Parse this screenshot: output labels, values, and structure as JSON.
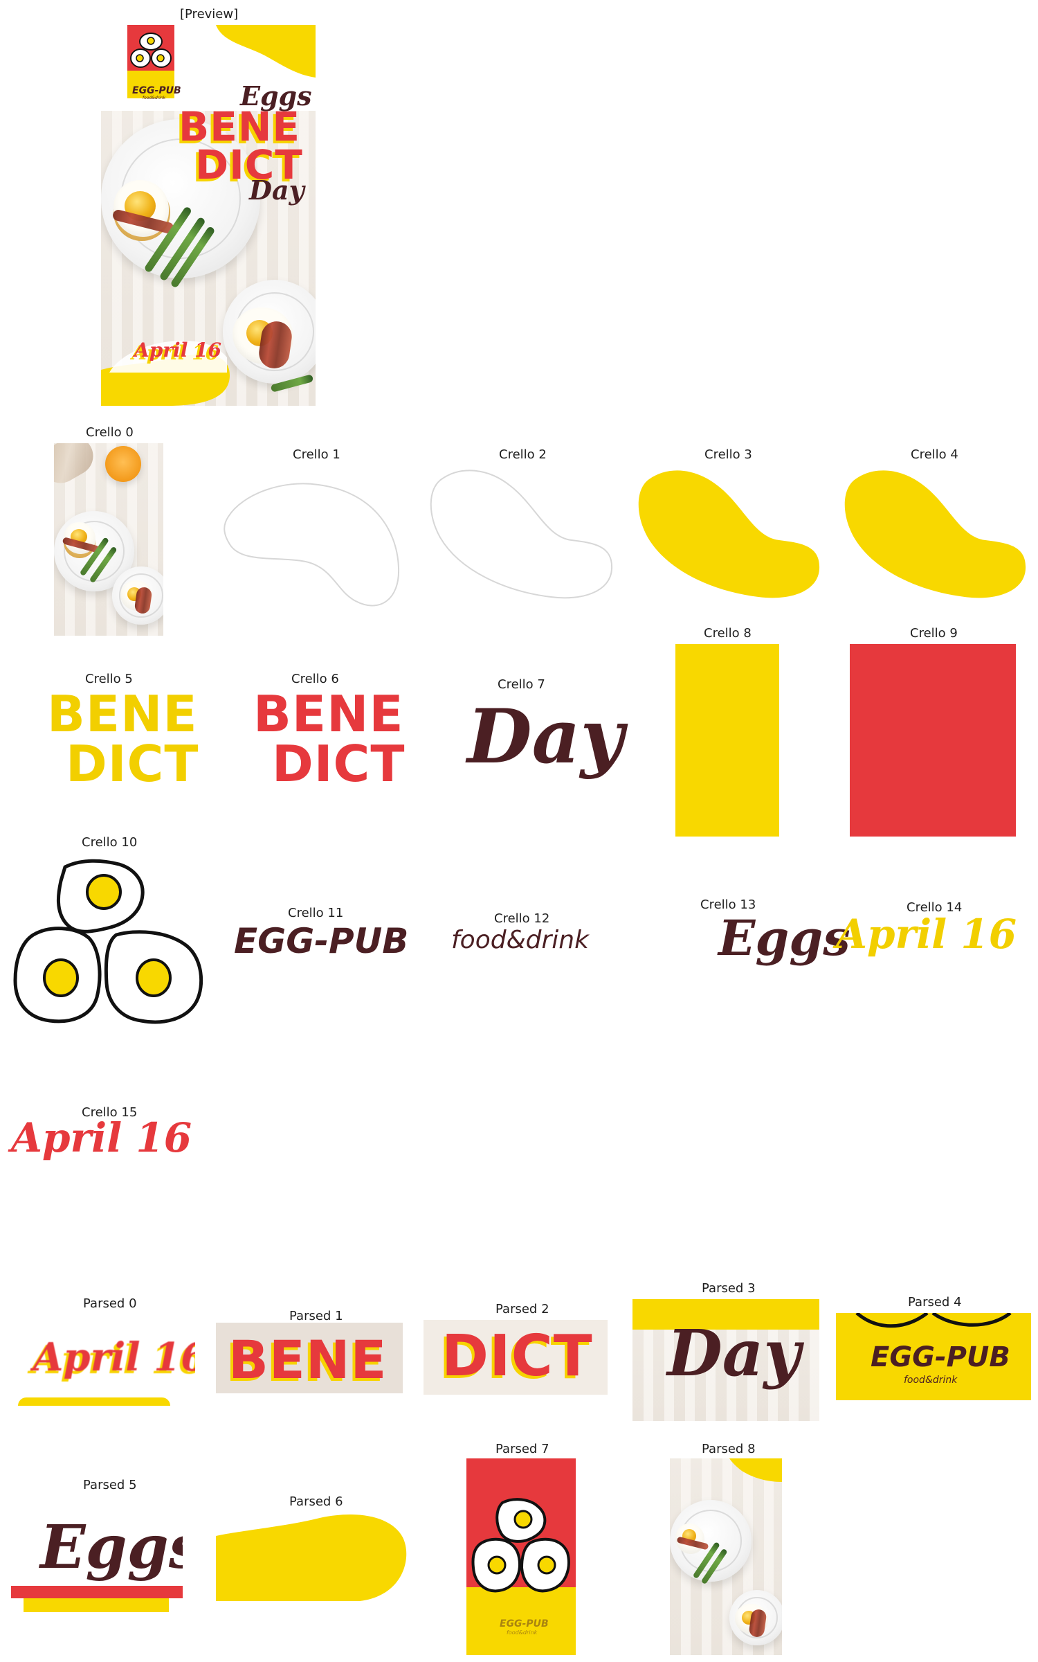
{
  "captions": {
    "preview": "[Preview]",
    "crello": [
      "Crello 0",
      "Crello 1",
      "Crello 2",
      "Crello 3",
      "Crello 4",
      "Crello 5",
      "Crello 6",
      "Crello 7",
      "Crello 8",
      "Crello 9",
      "Crello 10",
      "Crello 11",
      "Crello 12",
      "Crello 13",
      "Crello 14",
      "Crello 15"
    ],
    "parsed": [
      "Parsed 0",
      "Parsed 1",
      "Parsed 2",
      "Parsed 3",
      "Parsed 4",
      "Parsed 5",
      "Parsed 6",
      "Parsed 7",
      "Parsed 8"
    ]
  },
  "texts": {
    "eggs": "Eggs",
    "bene": "BENE",
    "dict": "DICT",
    "day": "Day",
    "egg_pub": "EGG-PUB",
    "food_drink": "food&drink",
    "april_16": "April 16"
  },
  "colors": {
    "yellow": "#f8d800",
    "red": "#e6393d",
    "dark": "#4b1f23"
  }
}
